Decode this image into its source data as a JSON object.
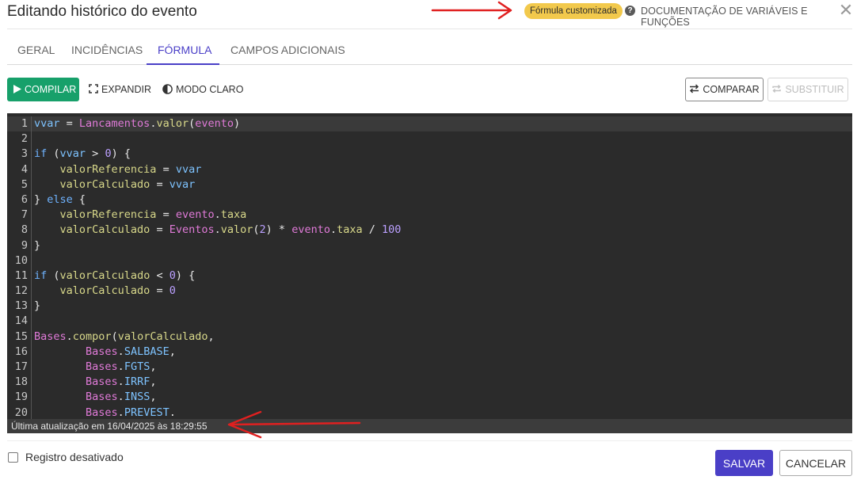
{
  "dialog": {
    "title": "Editando histórico do evento",
    "badge": "Fórmula customizada",
    "doc_link": "DOCUMENTAÇÃO DE VARIÁVEIS E FUNÇÕES",
    "help_glyph": "?",
    "close_glyph": "✕"
  },
  "tabs": [
    {
      "label": "GERAL"
    },
    {
      "label": "INCIDÊNCIAS"
    },
    {
      "label": "FÓRMULA",
      "active": true
    },
    {
      "label": "CAMPOS ADICIONAIS"
    }
  ],
  "toolbar": {
    "compile": "COMPILAR",
    "expand": "EXPANDIR",
    "light_mode": "MODO CLARO",
    "compare": "COMPARAR",
    "replace": "SUBSTITUIR"
  },
  "editor": {
    "lines": [
      {
        "n": "1",
        "tokens": [
          [
            "v",
            "vvar"
          ],
          [
            "o",
            " = "
          ],
          [
            "p",
            "Lancamentos"
          ],
          [
            "o",
            "."
          ],
          [
            "g",
            "valor"
          ],
          [
            "o",
            "("
          ],
          [
            "p",
            "evento"
          ],
          [
            "o",
            ")"
          ]
        ]
      },
      {
        "n": "2",
        "tokens": []
      },
      {
        "n": "3",
        "tokens": [
          [
            "k",
            "if"
          ],
          [
            "o",
            " ("
          ],
          [
            "v",
            "vvar"
          ],
          [
            "o",
            " > "
          ],
          [
            "n",
            "0"
          ],
          [
            "o",
            ") {"
          ]
        ]
      },
      {
        "n": "4",
        "tokens": [
          [
            "o",
            "    "
          ],
          [
            "g",
            "valorReferencia"
          ],
          [
            "o",
            " = "
          ],
          [
            "v",
            "vvar"
          ]
        ]
      },
      {
        "n": "5",
        "tokens": [
          [
            "o",
            "    "
          ],
          [
            "g",
            "valorCalculado"
          ],
          [
            "o",
            " = "
          ],
          [
            "v",
            "vvar"
          ]
        ]
      },
      {
        "n": "6",
        "tokens": [
          [
            "o",
            "} "
          ],
          [
            "k",
            "else"
          ],
          [
            "o",
            " {"
          ]
        ]
      },
      {
        "n": "7",
        "tokens": [
          [
            "o",
            "    "
          ],
          [
            "g",
            "valorReferencia"
          ],
          [
            "o",
            " = "
          ],
          [
            "p",
            "evento"
          ],
          [
            "o",
            "."
          ],
          [
            "g",
            "taxa"
          ]
        ]
      },
      {
        "n": "8",
        "tokens": [
          [
            "o",
            "    "
          ],
          [
            "g",
            "valorCalculado"
          ],
          [
            "o",
            " = "
          ],
          [
            "p",
            "Eventos"
          ],
          [
            "o",
            "."
          ],
          [
            "g",
            "valor"
          ],
          [
            "o",
            "("
          ],
          [
            "n",
            "2"
          ],
          [
            "o",
            ") * "
          ],
          [
            "p",
            "evento"
          ],
          [
            "o",
            "."
          ],
          [
            "g",
            "taxa"
          ],
          [
            "o",
            " / "
          ],
          [
            "n",
            "100"
          ]
        ]
      },
      {
        "n": "9",
        "tokens": [
          [
            "o",
            "}"
          ]
        ]
      },
      {
        "n": "10",
        "tokens": []
      },
      {
        "n": "11",
        "tokens": [
          [
            "k",
            "if"
          ],
          [
            "o",
            " ("
          ],
          [
            "g",
            "valorCalculado"
          ],
          [
            "o",
            " < "
          ],
          [
            "n",
            "0"
          ],
          [
            "o",
            ") {"
          ]
        ]
      },
      {
        "n": "12",
        "tokens": [
          [
            "o",
            "    "
          ],
          [
            "g",
            "valorCalculado"
          ],
          [
            "o",
            " = "
          ],
          [
            "n",
            "0"
          ]
        ]
      },
      {
        "n": "13",
        "tokens": [
          [
            "o",
            "}"
          ]
        ]
      },
      {
        "n": "14",
        "tokens": []
      },
      {
        "n": "15",
        "tokens": [
          [
            "p",
            "Bases"
          ],
          [
            "o",
            "."
          ],
          [
            "g",
            "compor"
          ],
          [
            "o",
            "("
          ],
          [
            "g",
            "valorCalculado"
          ],
          [
            "o",
            ","
          ]
        ]
      },
      {
        "n": "16",
        "tokens": [
          [
            "o",
            "        "
          ],
          [
            "p",
            "Bases"
          ],
          [
            "o",
            "."
          ],
          [
            "v",
            "SALBASE"
          ],
          [
            "o",
            ","
          ]
        ]
      },
      {
        "n": "17",
        "tokens": [
          [
            "o",
            "        "
          ],
          [
            "p",
            "Bases"
          ],
          [
            "o",
            "."
          ],
          [
            "v",
            "FGTS"
          ],
          [
            "o",
            ","
          ]
        ]
      },
      {
        "n": "18",
        "tokens": [
          [
            "o",
            "        "
          ],
          [
            "p",
            "Bases"
          ],
          [
            "o",
            "."
          ],
          [
            "v",
            "IRRF"
          ],
          [
            "o",
            ","
          ]
        ]
      },
      {
        "n": "19",
        "tokens": [
          [
            "o",
            "        "
          ],
          [
            "p",
            "Bases"
          ],
          [
            "o",
            "."
          ],
          [
            "v",
            "INSS"
          ],
          [
            "o",
            ","
          ]
        ]
      },
      {
        "n": "20",
        "tokens": [
          [
            "o",
            "        "
          ],
          [
            "p",
            "Bases"
          ],
          [
            "o",
            "."
          ],
          [
            "v",
            "PREVEST"
          ],
          [
            "o",
            "."
          ]
        ]
      }
    ],
    "status": "Última atualização em 16/04/2025 às 18:29:55"
  },
  "footer": {
    "checkbox_label": "Registro desativado",
    "checkbox_checked": false,
    "save": "SALVAR",
    "cancel": "CANCELAR"
  },
  "colors": {
    "accent": "#4a3fc7",
    "compile": "#17a06a",
    "badge": "#f2c94c",
    "editor_bg": "#2b2b2b",
    "annotation_arrow": "#e02020"
  }
}
